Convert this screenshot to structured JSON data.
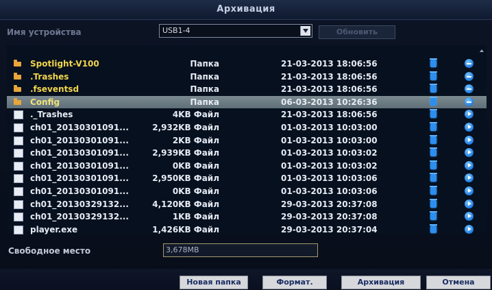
{
  "title": "Архивация",
  "device": {
    "label": "Имя устройства",
    "value": "USB1-4",
    "refresh_label": "Обновить"
  },
  "files": [
    {
      "type": "folder",
      "name": "Spotlight-V100",
      "size": "Папка",
      "date": "21-03-2013 18:06:56",
      "action": "collapse"
    },
    {
      "type": "folder",
      "name": ".Trashes",
      "size": "Папка",
      "date": "21-03-2013 18:06:56",
      "action": "collapse"
    },
    {
      "type": "folder",
      "name": ".fseventsd",
      "size": "Папка",
      "date": "21-03-2013 18:06:56",
      "action": "collapse"
    },
    {
      "type": "folder",
      "name": "Config",
      "size": "Папка",
      "date": "06-03-2013 10:26:36",
      "action": "collapse",
      "selected": true
    },
    {
      "type": "file",
      "name": "._Trashes",
      "size": "4KB Файл",
      "date": "21-03-2013 18:06:56",
      "action": "play"
    },
    {
      "type": "file",
      "name": "ch01_20130301091...",
      "size": "2,932KB Файл",
      "date": "01-03-2013 10:03:00",
      "action": "play"
    },
    {
      "type": "file",
      "name": "ch01_20130301091...",
      "size": "2KB Файл",
      "date": "01-03-2013 10:03:00",
      "action": "play"
    },
    {
      "type": "file",
      "name": "ch01_20130301091...",
      "size": "2,939KB Файл",
      "date": "01-03-2013 10:03:02",
      "action": "play"
    },
    {
      "type": "file",
      "name": "ch01_20130301091...",
      "size": "0KB Файл",
      "date": "01-03-2013 10:03:02",
      "action": "play"
    },
    {
      "type": "file",
      "name": "ch01_20130301091...",
      "size": "2,950KB Файл",
      "date": "01-03-2013 10:03:06",
      "action": "play"
    },
    {
      "type": "file",
      "name": "ch01_20130301091...",
      "size": "0KB Файл",
      "date": "01-03-2013 10:03:06",
      "action": "play"
    },
    {
      "type": "file",
      "name": "ch01_20130329132...",
      "size": "4,120KB Файл",
      "date": "29-03-2013 20:37:08",
      "action": "play"
    },
    {
      "type": "file",
      "name": "ch01_20130329132...",
      "size": "1KB Файл",
      "date": "29-03-2013 20:37:08",
      "action": "play"
    },
    {
      "type": "file",
      "name": "player.exe",
      "size": "1,426KB Файл",
      "date": "29-03-2013 20:37:04",
      "action": "play"
    }
  ],
  "free_space": {
    "label": "Свободное место",
    "value": "3,678MB"
  },
  "buttons": {
    "new_folder": "Новая папка",
    "format": "Формат.",
    "backup": "Архивация",
    "cancel": "Отмена"
  }
}
